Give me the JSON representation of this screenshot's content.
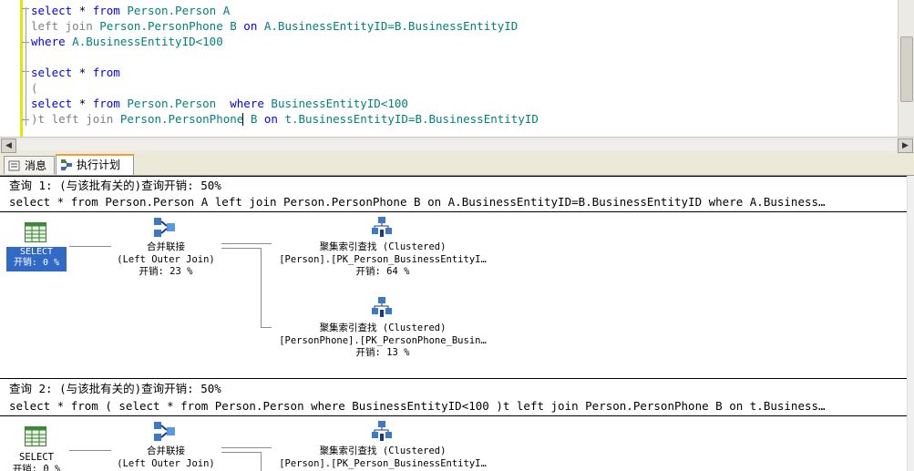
{
  "editor": {
    "lines": [
      {
        "kw": "select",
        "t1": " * ",
        "kw2": "from",
        "id": " Person.Person A",
        "rest": ""
      },
      {
        "gr": "left join",
        "id": " Person.PersonPhone B",
        "kw": " on",
        "id2": " A.BusinessEntityID=B.BusinessEntityID"
      },
      {
        "kw": "where",
        "id": " A.BusinessEntityID<100"
      },
      {
        "kw": "select",
        "t1": " * ",
        "kw2": "from"
      },
      {
        "gr": "("
      },
      {
        "kw": "select",
        "t1": " * ",
        "kw2": "from",
        "id": " Person.Person ",
        "kw3": " where",
        "id2": " BusinessEntityID<100"
      },
      {
        "gr": ")t left join",
        "id": " Person.PersonPhone B",
        "kw": " on",
        "id2": " t.BusinessEntityID=B.BusinessEntityID"
      }
    ]
  },
  "scroll": {
    "left_arrow": "◀",
    "right_arrow": "▶"
  },
  "tabs": [
    {
      "label": "消息"
    },
    {
      "label": "执行计划"
    }
  ],
  "queries": [
    {
      "header": "查询 1: (与该批有关的)查询开销: 50%",
      "sql": "select * from Person.Person A left join Person.PersonPhone B on A.BusinessEntityID=B.BusinessEntityID where A.Business…",
      "select_label": "SELECT",
      "select_cost": "开销: 0 %",
      "merge_title": "合并联接",
      "merge_sub": "(Left Outer Join)",
      "merge_cost": "开销: 23 %",
      "scan1_title": "聚集索引查找 (Clustered)",
      "scan1_obj": "[Person].[PK_Person_BusinessEntityI…",
      "scan1_cost": "开销: 64 %",
      "scan2_title": "聚集索引查找 (Clustered)",
      "scan2_obj": "[PersonPhone].[PK_PersonPhone_Busin…",
      "scan2_cost": "开销: 13 %"
    },
    {
      "header": "查询 2: (与该批有关的)查询开销: 50%",
      "sql": "select * from ( select * from Person.Person where BusinessEntityID<100 )t left join Person.PersonPhone B on t.Business…",
      "select_label": "SELECT",
      "select_cost": "开销: 0 %",
      "merge_title": "合并联接",
      "merge_sub": "(Left Outer Join)",
      "scan1_title": "聚集索引查找 (Clustered)",
      "scan1_obj": "[Person].[PK_Person_BusinessEntityI…"
    }
  ]
}
